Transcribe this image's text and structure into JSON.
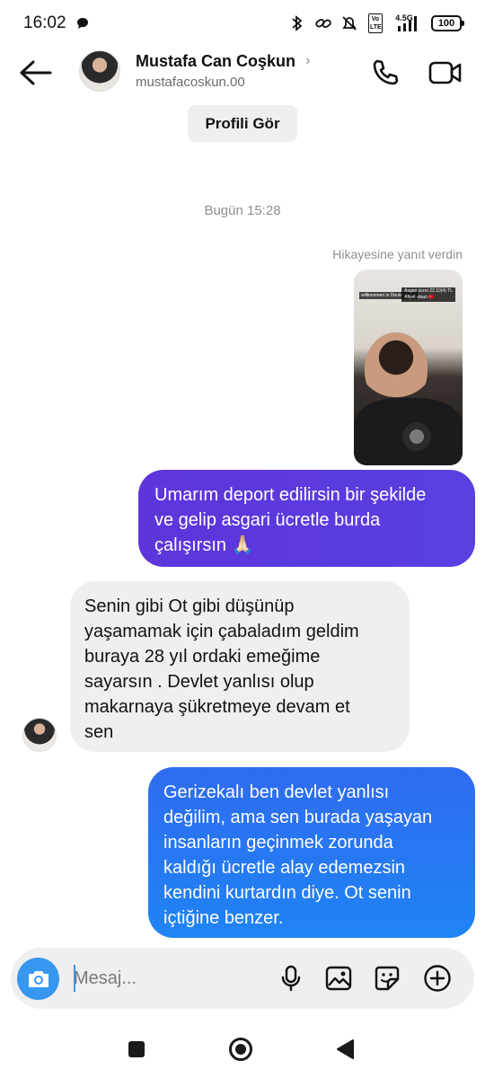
{
  "status_bar": {
    "time": "16:02",
    "network_label": "4.5G",
    "volte_label": "Vo LTE",
    "battery": "100"
  },
  "header": {
    "name": "Mustafa Can Coşkun",
    "chevron": "›",
    "username": "mustafacoskun.00",
    "icons": [
      "back-arrow-icon",
      "phone-icon",
      "video-icon"
    ]
  },
  "profile_button": "Profili Gör",
  "date_separator": "Bugün 15:28",
  "reply_note": "Hikayesine yanıt verdin",
  "story": {
    "label_left": "willkommen in Deutschland",
    "label_right": "Asgari ücret 22.10(4) TL\nAfiyet olsun 🇹🇷"
  },
  "messages": [
    {
      "direction": "outgoing",
      "text": "Umarım deport edilirsin bir şekilde\nve gelip asgari ücretle burda\nçalışırsın 🙏🏻"
    },
    {
      "direction": "incoming",
      "text": "Senin gibi Ot gibi düşünüp\nyaşamamak için çabaladım geldim\nburaya  28 yıl ordaki emeğime\nsayarsın . Devlet yanlısı olup\nmakarnaya şükretmeye devam et\nsen"
    },
    {
      "direction": "outgoing",
      "text": "Gerizekalı ben devlet yanlısı\ndeğilim, ama sen burada yaşayan\ninsanların geçinmek zorunda\nkaldığı ücretle alay edemezsin\nkendini kurtardın diye. Ot senin\niçtiğine benzer."
    }
  ],
  "composer": {
    "placeholder": "Mesaj...",
    "value": "",
    "accent_color": "#3797f0",
    "icons": [
      "camera-icon",
      "microphone-icon",
      "gallery-icon",
      "sticker-icon",
      "plus-icon"
    ]
  },
  "colors": {
    "outgoing_purple": "#5a3fe0",
    "outgoing_blue": "#2478f2",
    "incoming_gray": "#efefef"
  }
}
